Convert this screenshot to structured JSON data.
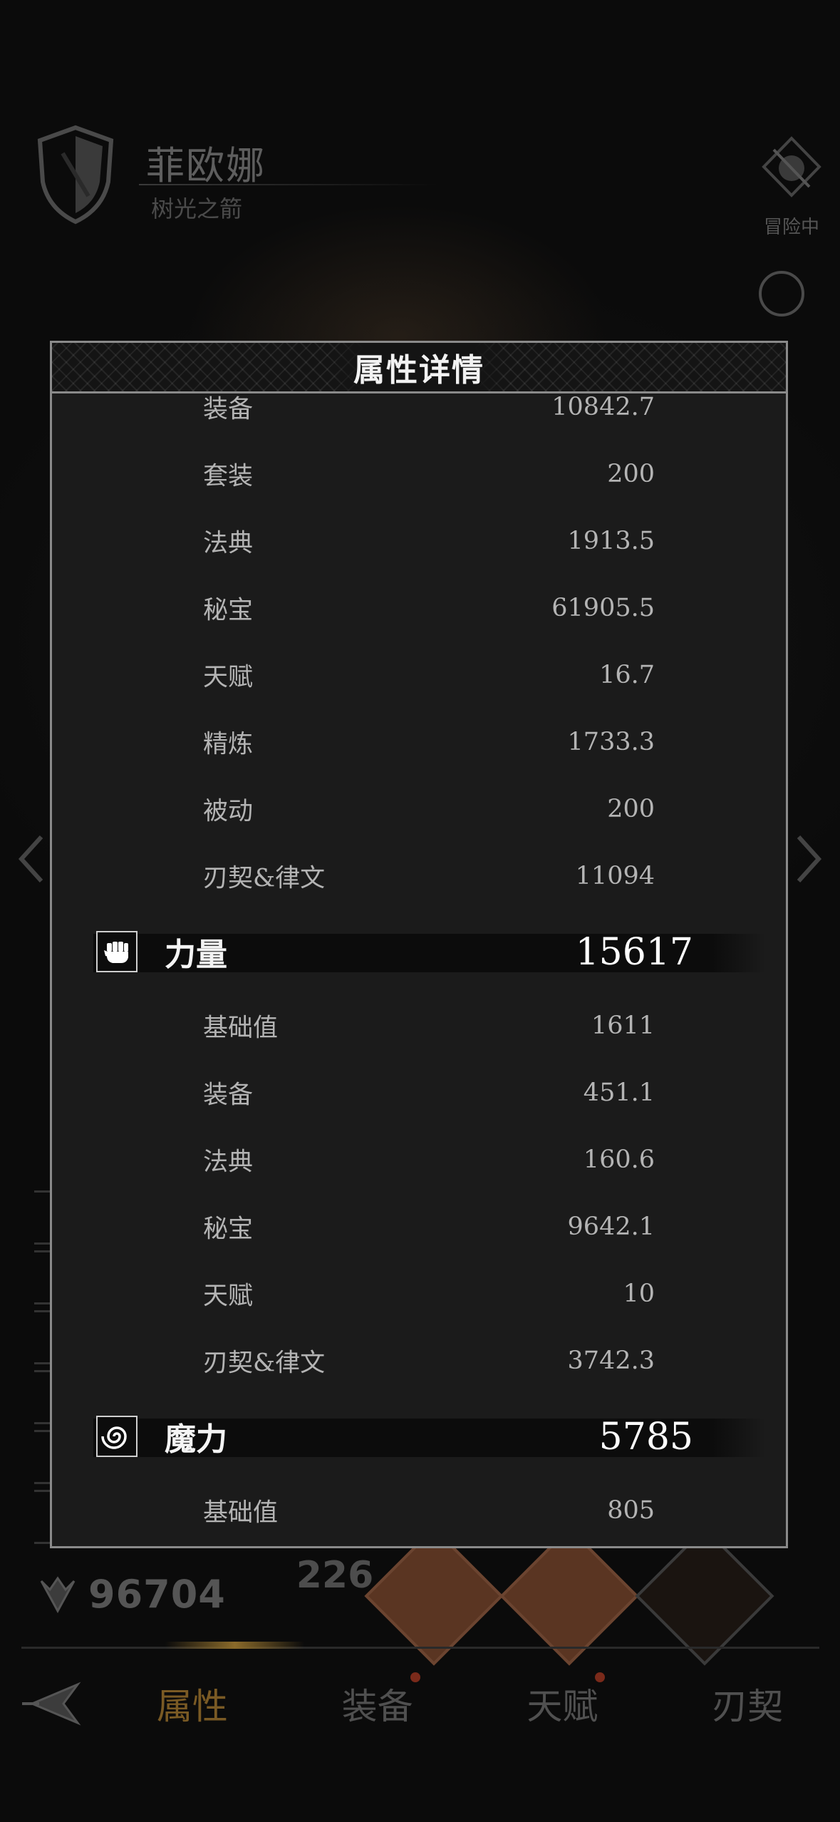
{
  "background": {
    "character_name": "菲欧娜",
    "character_subtitle": "树光之箭",
    "adventure_label": "冒险中",
    "combat_power": "96704",
    "diamond_number": "226"
  },
  "tabs": [
    {
      "label": "属性",
      "active": true
    },
    {
      "label": "装备",
      "badge": true
    },
    {
      "label": "天赋",
      "badge": true
    },
    {
      "label": "刃契"
    }
  ],
  "modal": {
    "title": "属性详情",
    "top_rows": [
      {
        "label": "装备",
        "value": "10842.7"
      },
      {
        "label": "套装",
        "value": "200"
      },
      {
        "label": "法典",
        "value": "1913.5"
      },
      {
        "label": "秘宝",
        "value": "61905.5"
      },
      {
        "label": "天赋",
        "value": "16.7"
      },
      {
        "label": "精炼",
        "value": "1733.3"
      },
      {
        "label": "被动",
        "value": "200"
      },
      {
        "label": "刃契&律文",
        "value": "11094"
      }
    ],
    "strength": {
      "name": "力量",
      "value": "15617",
      "icon": "fist-icon",
      "rows": [
        {
          "label": "基础值",
          "value": "1611"
        },
        {
          "label": "装备",
          "value": "451.1"
        },
        {
          "label": "法典",
          "value": "160.6"
        },
        {
          "label": "秘宝",
          "value": "9642.1"
        },
        {
          "label": "天赋",
          "value": "10"
        },
        {
          "label": "刃契&律文",
          "value": "3742.3"
        }
      ]
    },
    "magic": {
      "name": "魔力",
      "value": "5785",
      "icon": "spiral-icon",
      "rows": [
        {
          "label": "基础值",
          "value": "805"
        }
      ]
    }
  },
  "colors": {
    "modal_bg": "#1b1b1b",
    "modal_border": "#8a8a8a",
    "active_tab": "#7a5a24"
  }
}
